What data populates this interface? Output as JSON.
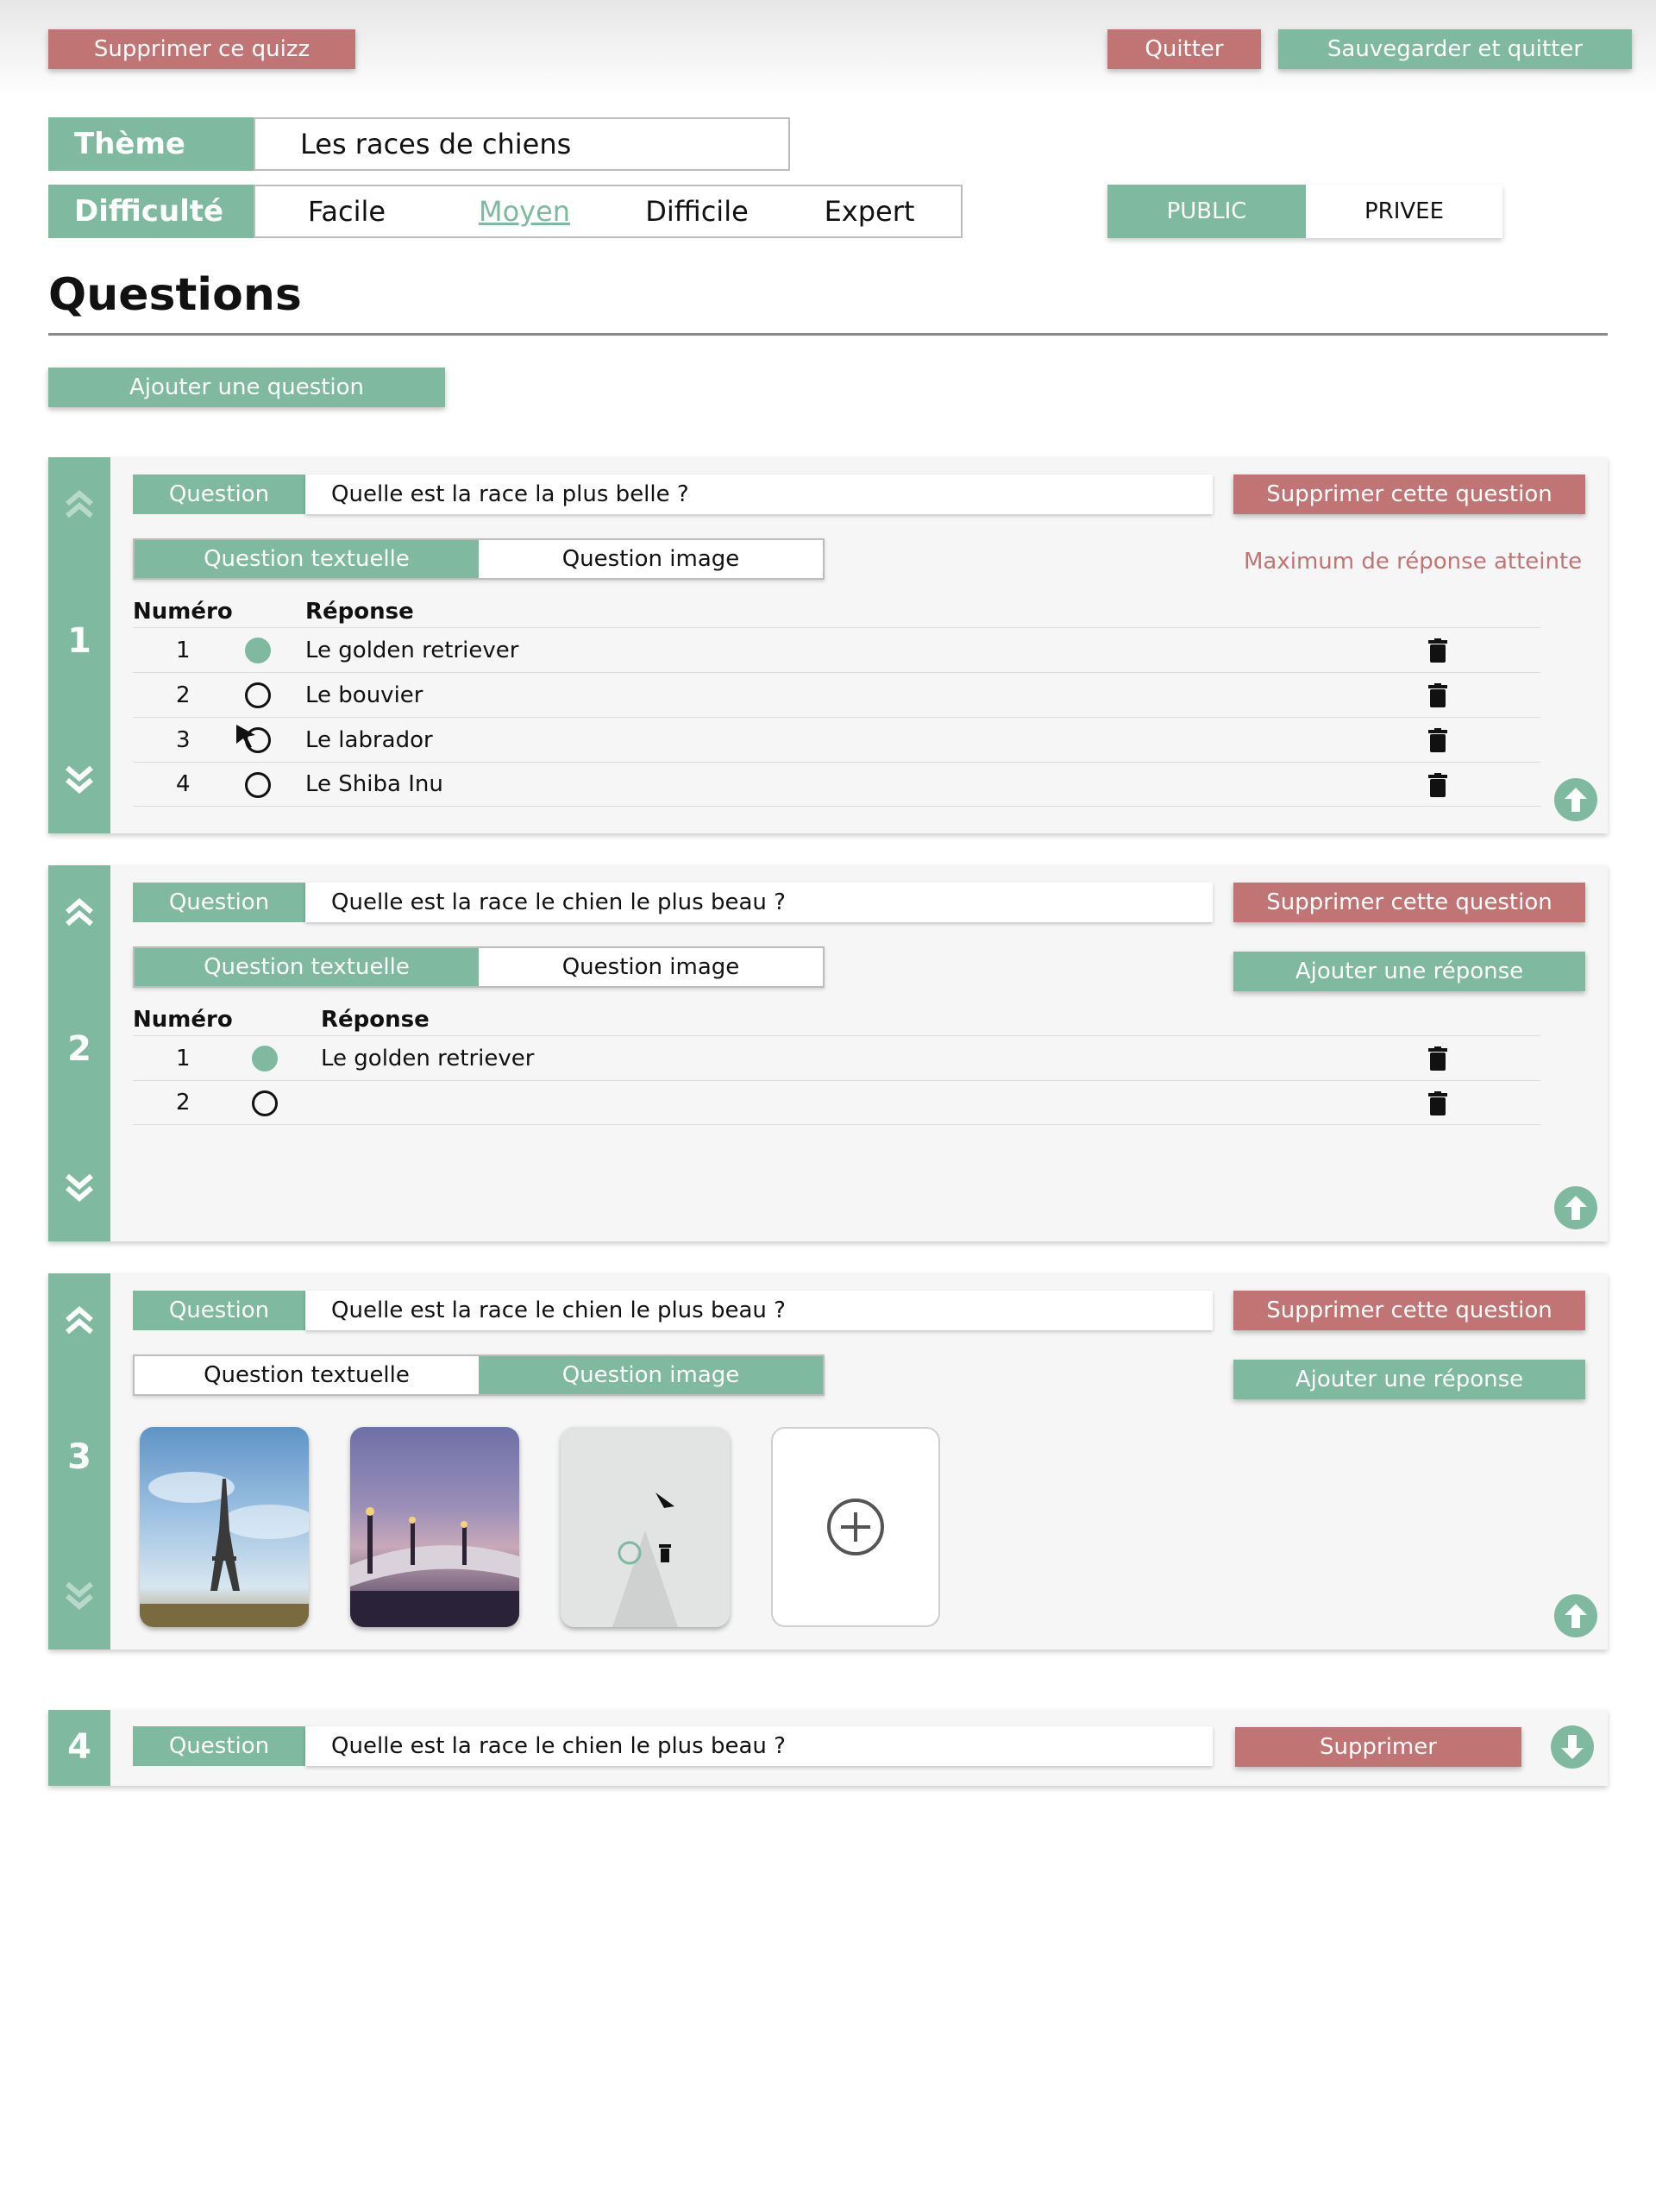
{
  "header": {
    "delete_quiz": "Supprimer ce quizz",
    "quit": "Quitter",
    "save_quit": "Sauvegarder et quitter"
  },
  "theme": {
    "label": "Thème",
    "value": "Les races de chiens"
  },
  "difficulty": {
    "label": "Difficulté",
    "options": [
      "Facile",
      "Moyen",
      "Difficile",
      "Expert"
    ],
    "selected": "Moyen"
  },
  "visibility": {
    "public": "PUBLIC",
    "private": "PRIVEE",
    "selected": "PUBLIC"
  },
  "questions_title": "Questions",
  "add_question": "Ajouter une question",
  "colors": {
    "accent": "#7eb9a0",
    "danger": "#c07474"
  },
  "questions": [
    {
      "number": "1",
      "label": "Question",
      "text": "Quelle est la race la plus belle ?",
      "delete": "Supprimer cette question",
      "type_text": "Question textuelle",
      "type_image": "Question image",
      "selected_type": "text",
      "max_reached": "Maximum de réponse atteinte",
      "col_num": "Numéro",
      "col_answer": "Réponse",
      "answers": [
        {
          "n": "1",
          "text": "Le golden retriever",
          "correct": true
        },
        {
          "n": "2",
          "text": "Le bouvier",
          "correct": false
        },
        {
          "n": "3",
          "text": "Le labrador",
          "correct": false
        },
        {
          "n": "4",
          "text": "Le Shiba Inu",
          "correct": false
        }
      ]
    },
    {
      "number": "2",
      "label": "Question",
      "text": "Quelle est la race le chien le plus beau ?",
      "delete": "Supprimer cette question",
      "type_text": "Question textuelle",
      "type_image": "Question image",
      "selected_type": "text",
      "add_answer": "Ajouter une réponse",
      "col_num": "Numéro",
      "col_answer": "Réponse",
      "answers": [
        {
          "n": "1",
          "text": "Le golden retriever",
          "correct": true
        },
        {
          "n": "2",
          "text": "",
          "correct": false
        }
      ]
    },
    {
      "number": "3",
      "label": "Question",
      "text": "Quelle est la race le chien le plus beau ?",
      "delete": "Supprimer cette question",
      "type_text": "Question textuelle",
      "type_image": "Question image",
      "selected_type": "image",
      "add_answer": "Ajouter une réponse",
      "images": [
        "eiffel-tower",
        "bridge-at-dusk",
        "city-aerial"
      ]
    },
    {
      "number": "4",
      "label": "Question",
      "text": "Quelle est la race le chien le plus beau ?",
      "delete": "Supprimer"
    }
  ]
}
